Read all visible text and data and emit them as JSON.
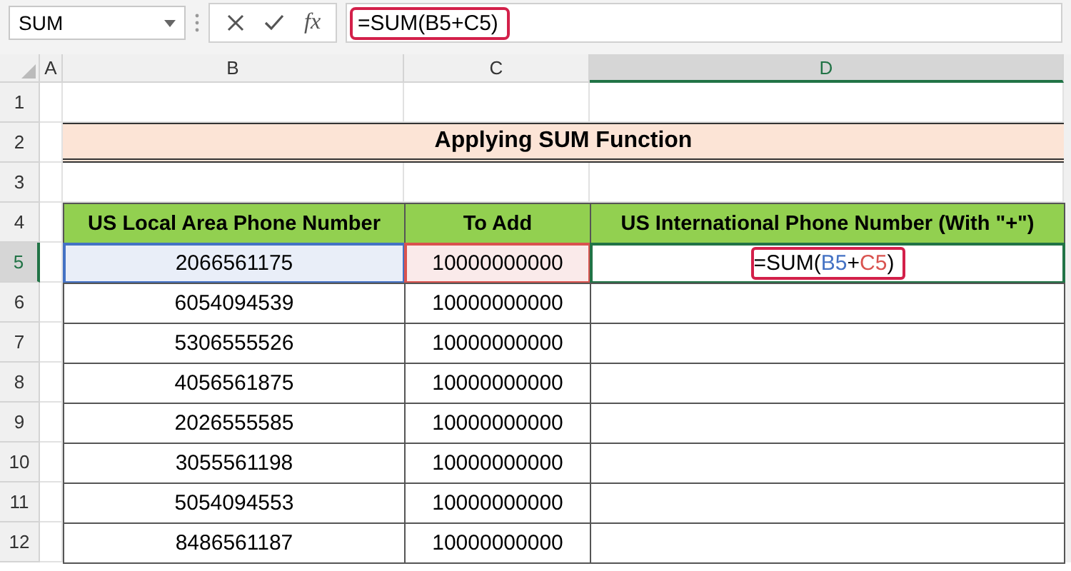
{
  "name_box": {
    "value": "SUM"
  },
  "formula_bar": {
    "function_label": "fx",
    "formula": "=SUM(B5+C5)"
  },
  "column_headers": [
    {
      "label": "A",
      "selected": false
    },
    {
      "label": "B",
      "selected": false
    },
    {
      "label": "C",
      "selected": false
    },
    {
      "label": "D",
      "selected": true
    }
  ],
  "row_headers": [
    {
      "label": "1",
      "selected": false
    },
    {
      "label": "2",
      "selected": false
    },
    {
      "label": "3",
      "selected": false
    },
    {
      "label": "4",
      "selected": false
    },
    {
      "label": "5",
      "selected": true
    },
    {
      "label": "6",
      "selected": false
    },
    {
      "label": "7",
      "selected": false
    },
    {
      "label": "8",
      "selected": false
    },
    {
      "label": "9",
      "selected": false
    },
    {
      "label": "10",
      "selected": false
    },
    {
      "label": "11",
      "selected": false
    },
    {
      "label": "12",
      "selected": false
    }
  ],
  "title": "Applying SUM Function",
  "table": {
    "columns": [
      "US Local Area Phone Number",
      "To Add",
      "US International Phone Number (With \"+\")"
    ],
    "rows": [
      {
        "cells": [
          {
            "text": "2066561175",
            "color": "#4472c4"
          },
          {
            "text": "10000000000",
            "color": "#d9534f"
          }
        ],
        "formula_parts": [
          {
            "text": "=SUM(",
            "color": "#000000"
          },
          {
            "text": "B5",
            "color": "#4472c4"
          },
          {
            "text": "+",
            "color": "#000000"
          },
          {
            "text": "C5",
            "color": "#d9534f"
          },
          {
            "text": ")",
            "color": "#000000"
          }
        ]
      },
      {
        "cells": [
          {
            "text": "6054094539"
          },
          {
            "text": "10000000000"
          }
        ]
      },
      {
        "cells": [
          {
            "text": "5306555526"
          },
          {
            "text": "10000000000"
          }
        ]
      },
      {
        "cells": [
          {
            "text": "4056561875"
          },
          {
            "text": "10000000000"
          }
        ]
      },
      {
        "cells": [
          {
            "text": "2026555585"
          },
          {
            "text": "10000000000"
          }
        ]
      },
      {
        "cells": [
          {
            "text": "3055561198"
          },
          {
            "text": "10000000000"
          }
        ]
      },
      {
        "cells": [
          {
            "text": "5054094553"
          },
          {
            "text": "10000000000"
          }
        ]
      },
      {
        "cells": [
          {
            "text": "8486561187"
          },
          {
            "text": "10000000000"
          }
        ]
      }
    ]
  }
}
